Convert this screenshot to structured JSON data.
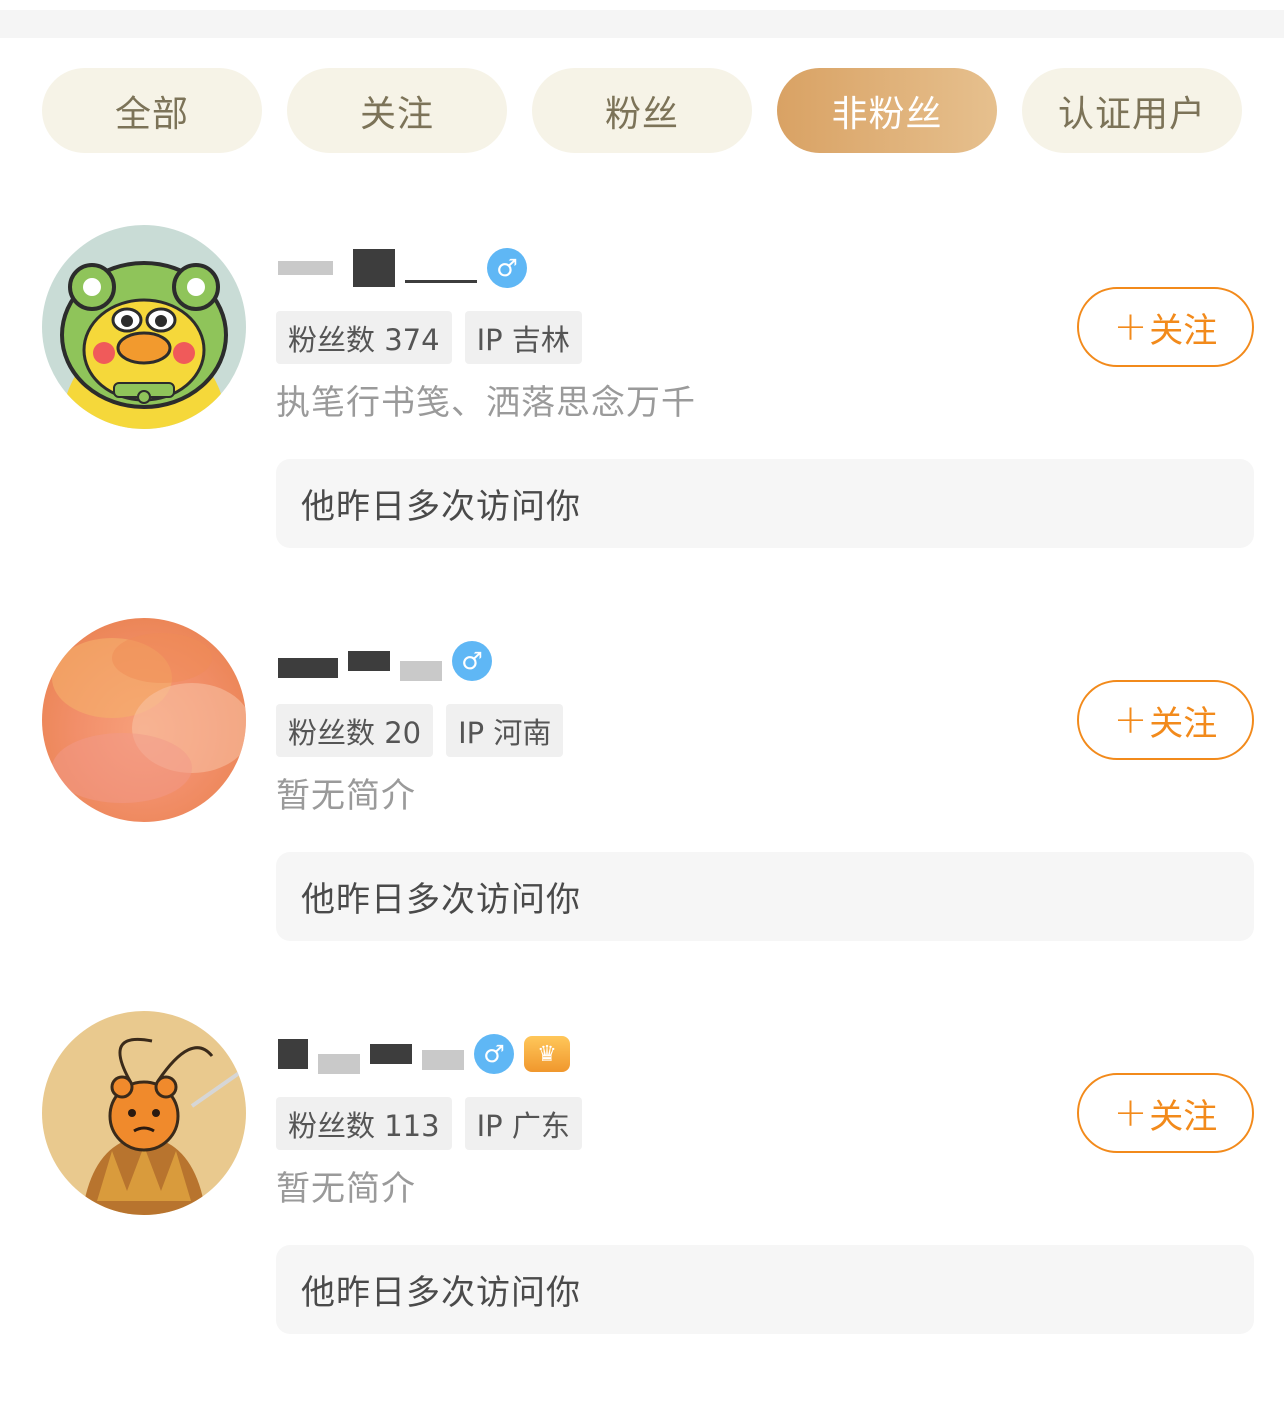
{
  "tabs": [
    {
      "label": "全部",
      "active": false
    },
    {
      "label": "关注",
      "active": false
    },
    {
      "label": "粉丝",
      "active": false
    },
    {
      "label": "非粉丝",
      "active": true
    },
    {
      "label": "认证用户",
      "active": false
    }
  ],
  "users": [
    {
      "avatar": "frog-duck-cartoon",
      "gender_icon": "male-icon",
      "fans": "粉丝数 374",
      "ip": "IP 吉林",
      "bio": "执笔行书笺、洒落思念万千",
      "follow": "关注",
      "visit": "他昨日多次访问你"
    },
    {
      "avatar": "orange-watercolor",
      "gender_icon": "male-icon",
      "fans": "粉丝数 20",
      "ip": "IP 河南",
      "bio": "暂无简介",
      "follow": "关注",
      "visit": "他昨日多次访问你"
    },
    {
      "avatar": "monkey-king-bear",
      "gender_icon": "male-icon",
      "fans": "粉丝数 113",
      "ip": "IP 广东",
      "bio": "暂无简介",
      "follow": "关注",
      "visit": "他昨日多次访问你"
    }
  ],
  "colors": {
    "accent": "#f28a1b",
    "tab_active_start": "#d9a264",
    "tab_active_end": "#e6c08e",
    "tab_bg": "#f6f3e7"
  }
}
